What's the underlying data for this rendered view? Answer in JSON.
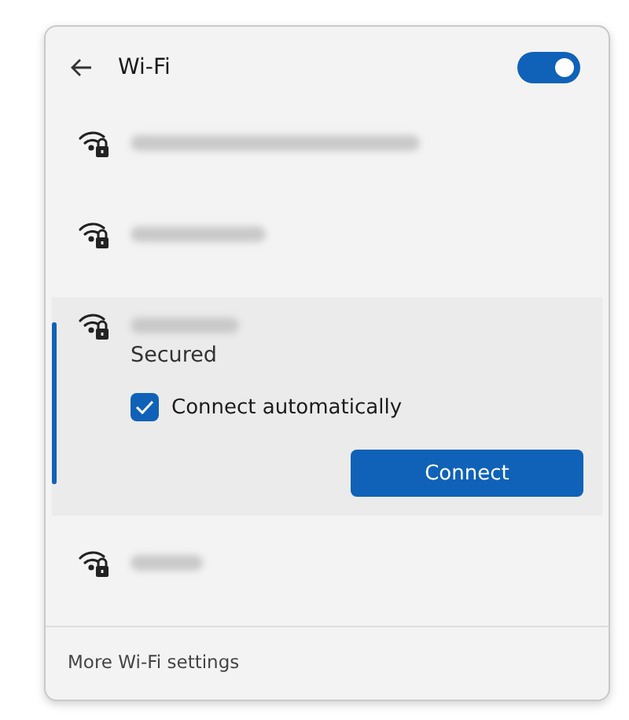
{
  "header": {
    "back_icon": true,
    "title": "Wi-Fi",
    "wifi_on": true
  },
  "networks": [
    {
      "selected": false
    },
    {
      "selected": false
    },
    {
      "selected": true,
      "status": "Secured",
      "connect_automatically": {
        "label": "Connect automatically",
        "checked": true
      },
      "button": "Connect"
    },
    {
      "selected": false
    }
  ],
  "footer": {
    "link": "More Wi-Fi settings"
  }
}
